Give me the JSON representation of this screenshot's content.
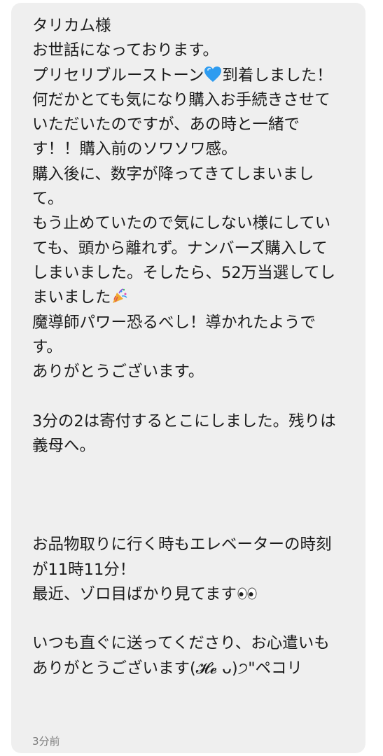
{
  "message": {
    "lines": [
      "タリカム様",
      "お世話になっております。",
      "プリセリブルーストーン",
      "到着しました！",
      "何だかとても気になり購入お手続きさせて",
      "いただいたのですが、あの時と一緒で",
      "す！！購入前のソワソワ感。",
      "購入後に、数字が降ってきてしまいまし",
      "て。",
      "もう止めていたので気にしない様にしてい",
      "ても、頭から離れず。ナンバーズ購入して",
      "しまいました。そしたら、52万当選してし",
      "まいました",
      "魔導師パワー恐るべし！導かれたようで",
      "す。",
      "ありがとうございます。",
      "3分の2は寄付するとこにしました。残りは",
      "義母へ。",
      "お品物取りに行く時もエレベーターの時刻",
      "が11時11分！",
      "最近、ゾロ目ばかり見てます",
      "いつも直ぐに送ってくださり、お心遣いも",
      "ありがとうございます(𝓗𝓮 ᴗ)੭\"ペコリ"
    ],
    "icons": {
      "blue_heart": "blue-heart-icon",
      "party_popper": "party-popper-icon",
      "eyes": "eyes-icon"
    }
  },
  "timestamp": "3分前",
  "colors": {
    "bubble_bg": "#efefef",
    "text": "#1b1b1b",
    "timestamp": "#7b7b7b",
    "heart": "#2e9cf0"
  }
}
